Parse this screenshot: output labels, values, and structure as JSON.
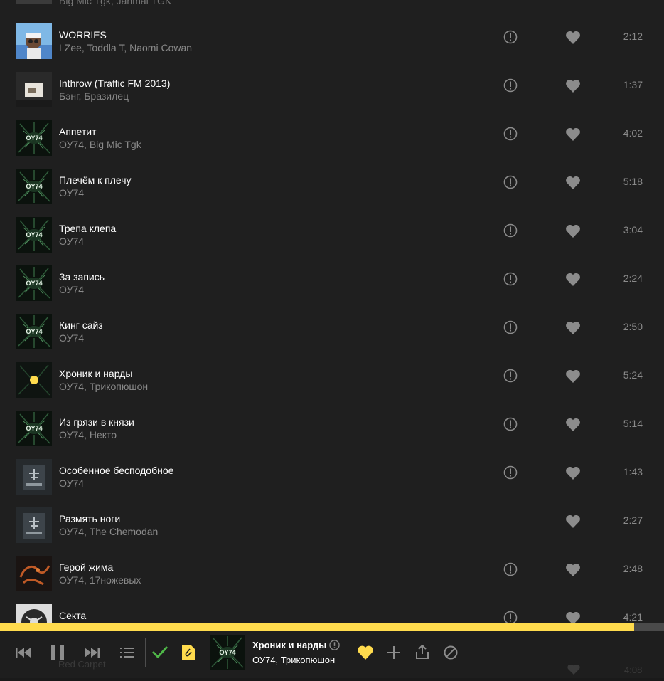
{
  "colors": {
    "accent": "#ffdb4d",
    "text_primary": "#ffffff",
    "text_secondary": "#8a8a8a",
    "icon": "#8c8c8c",
    "background": "#1f1f1f"
  },
  "partial_top_row": {
    "artists": "Big Mic Tgk, Jahmal TGK"
  },
  "tracks": [
    {
      "title": "WORRIES",
      "artists": "LZee, Toddla T, Naomi Cowan",
      "duration": "2:12",
      "cover": "photo",
      "has_info": true
    },
    {
      "title": "Inthrow (Traffic FM 2013)",
      "artists": "Бэнг, Бразилец",
      "duration": "1:37",
      "cover": "room",
      "has_info": true
    },
    {
      "title": "Аппетит",
      "artists": "ОУ74, Big Mic Tgk",
      "duration": "4:02",
      "cover": "ou74",
      "has_info": true
    },
    {
      "title": "Плечём к плечу",
      "artists": "ОУ74",
      "duration": "5:18",
      "cover": "ou74",
      "has_info": true
    },
    {
      "title": "Трепа клепа",
      "artists": "ОУ74",
      "duration": "3:04",
      "cover": "ou74",
      "has_info": true
    },
    {
      "title": "За запись",
      "artists": "ОУ74",
      "duration": "2:24",
      "cover": "ou74",
      "has_info": true
    },
    {
      "title": "Кинг сайз",
      "artists": "ОУ74",
      "duration": "2:50",
      "cover": "ou74",
      "has_info": true
    },
    {
      "title": "Хроник и нарды",
      "artists": "ОУ74, Трикопюшон",
      "duration": "5:24",
      "cover": "playing",
      "has_info": true
    },
    {
      "title": "Из грязи в князи",
      "artists": "ОУ74, Некто",
      "duration": "5:14",
      "cover": "ou74",
      "has_info": true
    },
    {
      "title": "Особенное бесподобное",
      "artists": "ОУ74",
      "duration": "1:43",
      "cover": "book",
      "has_info": true
    },
    {
      "title": "Размять ноги",
      "artists": "ОУ74, The Chemodan",
      "duration": "2:27",
      "cover": "book",
      "has_info": false
    },
    {
      "title": "Герой жима",
      "artists": "ОУ74, 17ножевых",
      "duration": "2:48",
      "cover": "dragon",
      "has_info": true
    },
    {
      "title": "Секта",
      "artists": "",
      "duration": "4:21",
      "cover": "sekta",
      "has_info": true
    }
  ],
  "player": {
    "progress": 0.955,
    "now_playing": {
      "title": "Хроник и нарды",
      "artist_primary": "ОУ74",
      "artist_rest": ", Трикопюшон",
      "liked": true
    },
    "ghost_next_title": "Red Carpet",
    "ghost_next_duration": "4:08",
    "icons": [
      "prev-icon",
      "pause-icon",
      "next-icon",
      "queue-icon",
      "check-icon",
      "clip-icon",
      "heart-icon",
      "plus-icon",
      "share-icon",
      "block-icon"
    ]
  }
}
